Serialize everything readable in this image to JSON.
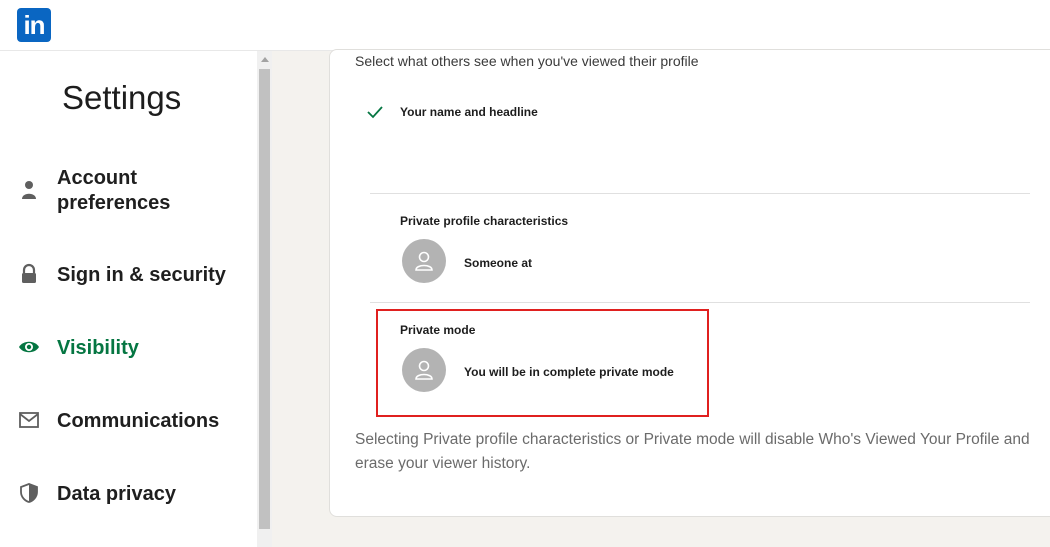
{
  "brand": {
    "logo_text": "in",
    "color": "#0a66c2"
  },
  "sidebar": {
    "title": "Settings",
    "active_color": "#057642",
    "items": [
      {
        "label": "Account preferences",
        "line1": "Account",
        "line2": "preferences",
        "icon": "person-icon"
      },
      {
        "label": "Sign in & security",
        "icon": "lock-icon"
      },
      {
        "label": "Visibility",
        "icon": "eye-icon",
        "active": true
      },
      {
        "label": "Communications",
        "icon": "envelope-icon"
      },
      {
        "label": "Data privacy",
        "icon": "shield-icon"
      }
    ]
  },
  "main": {
    "intro": "Select what others see when you've viewed their profile",
    "options": [
      {
        "title": "Your name and headline",
        "selected": true
      },
      {
        "title": "Private profile characteristics",
        "description": "Someone at"
      },
      {
        "title": "Private mode",
        "description": "You will be in complete private mode"
      }
    ],
    "footnote": "Selecting Private profile characteristics or Private mode will disable Who's Viewed Your Profile and erase your viewer history."
  }
}
